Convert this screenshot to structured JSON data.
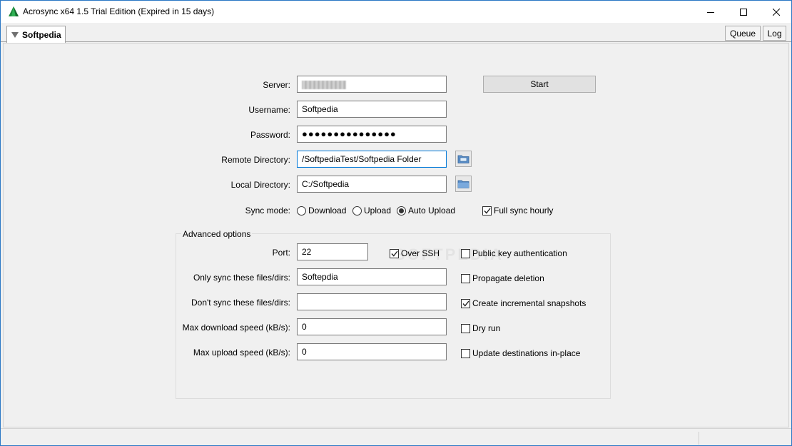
{
  "window": {
    "title": "Acrosync x64 1.5 Trial Edition (Expired in 15 days)"
  },
  "tabs": {
    "active_label": "Softpedia",
    "queue_label": "Queue",
    "log_label": "Log"
  },
  "form": {
    "server_label": "Server:",
    "username_label": "Username:",
    "username_value": "Softpedia",
    "password_label": "Password:",
    "password_value": "●●●●●●●●●●●●●●●",
    "remote_dir_label": "Remote Directory:",
    "remote_dir_value": "/SoftpediaTest/Softpedia Folder",
    "local_dir_label": "Local Directory:",
    "local_dir_value": "C:/Softpedia",
    "start_label": "Start",
    "sync_mode_label": "Sync mode:",
    "sync_modes": [
      "Download",
      "Upload",
      "Auto Upload"
    ],
    "sync_mode_selected": "Auto Upload",
    "full_sync_label": "Full sync hourly",
    "full_sync_checked": true
  },
  "advanced": {
    "group_title": "Advanced options",
    "port_label": "Port:",
    "port_value": "22",
    "over_ssh_label": "Over SSH",
    "over_ssh_checked": true,
    "only_sync_label": "Only sync these files/dirs:",
    "only_sync_value": "Softepdia",
    "dont_sync_label": "Don't sync these files/dirs:",
    "dont_sync_value": "",
    "max_download_label": "Max download speed (kB/s):",
    "max_download_value": "0",
    "max_upload_label": "Max upload speed (kB/s):",
    "max_upload_value": "0",
    "options": [
      {
        "label": "Public key authentication",
        "checked": false
      },
      {
        "label": "Propagate deletion",
        "checked": false
      },
      {
        "label": "Create incremental snapshots",
        "checked": true
      },
      {
        "label": "Dry run",
        "checked": false
      },
      {
        "label": "Update destinations in-place",
        "checked": false
      }
    ]
  },
  "watermark": "SOFTPEDIA",
  "colors": {
    "accent": "#0078d7",
    "window_border": "#2b78c5",
    "background": "#f0f0f0",
    "app_icon": "#1e8a3c"
  }
}
